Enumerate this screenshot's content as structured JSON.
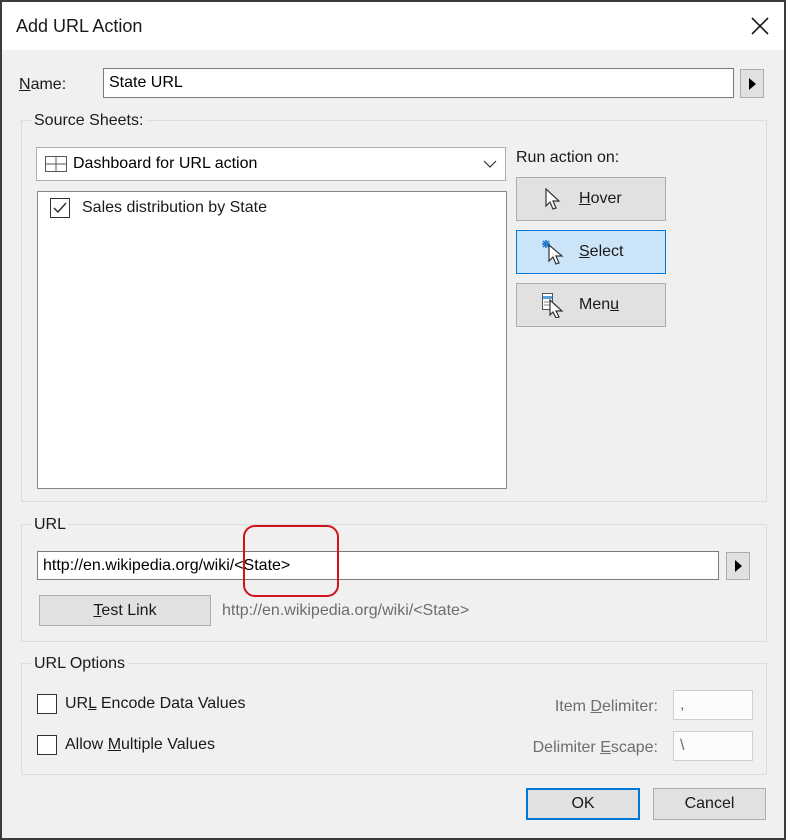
{
  "dialog": {
    "title": "Add URL Action",
    "close_icon": "close-icon"
  },
  "name_field": {
    "label_underlined": "N",
    "label_rest": "ame:",
    "value": "State URL",
    "insert_menu_icon": "triangle-right-icon"
  },
  "source_sheets": {
    "legend": "Source Sheets:",
    "dropdown": {
      "icon": "dashboard-grid-icon",
      "selected": "Dashboard for URL action",
      "chevron": "chevron-down-icon"
    },
    "sheets": [
      {
        "label": "Sales distribution by State",
        "checked": true
      }
    ]
  },
  "run_action": {
    "label": "Run action on:",
    "options": [
      {
        "pre": "",
        "underlined": "H",
        "post": "over",
        "icon": "hover-cursor-icon",
        "selected": false
      },
      {
        "pre": "",
        "underlined": "S",
        "post": "elect",
        "icon": "select-cursor-icon",
        "selected": true
      },
      {
        "pre": "Men",
        "underlined": "u",
        "post": "",
        "icon": "menu-cursor-icon",
        "selected": false
      }
    ]
  },
  "url_section": {
    "legend": "URL",
    "value": "http://en.wikipedia.org/wiki/<State>",
    "insert_menu_icon": "triangle-right-icon",
    "test_link": {
      "underlined": "T",
      "rest": "est Link"
    },
    "preview": "http://en.wikipedia.org/wiki/<State>"
  },
  "url_options": {
    "legend": "URL Options",
    "checkboxes": [
      {
        "pre": "UR",
        "underlined": "L",
        "post": " Encode Data Values",
        "checked": false
      },
      {
        "pre": "Allow ",
        "underlined": "M",
        "post": "ultiple Values",
        "checked": false
      }
    ],
    "item_delimiter": {
      "pre": "Item ",
      "underlined": "D",
      "post": "elimiter:",
      "value": ","
    },
    "delimiter_escape": {
      "pre": "Delimiter ",
      "underlined": "E",
      "post": "scape:",
      "value": "\\"
    }
  },
  "footer": {
    "ok_label": "OK",
    "cancel_label": "Cancel"
  },
  "annotation": {
    "color": "#d0141a"
  },
  "colors": {
    "selected_bg": "#cce4f7",
    "selected_border": "#0078d7"
  }
}
